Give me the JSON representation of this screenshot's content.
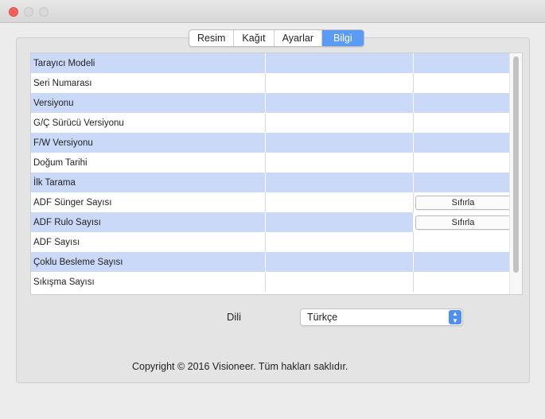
{
  "tabs": [
    {
      "label": "Resim",
      "active": false
    },
    {
      "label": "Kağıt",
      "active": false
    },
    {
      "label": "Ayarlar",
      "active": false
    },
    {
      "label": "Bilgi",
      "active": true
    }
  ],
  "rows": [
    {
      "label": "Tarayıcı Modeli",
      "value": "",
      "extra": ""
    },
    {
      "label": "Seri Numarası",
      "value": "",
      "extra": ""
    },
    {
      "label": "Versiyonu",
      "value": "",
      "extra": ""
    },
    {
      "label": "G/Ç Sürücü Versiyonu",
      "value": "",
      "extra": ""
    },
    {
      "label": "F/W Versiyonu",
      "value": "",
      "extra": ""
    },
    {
      "label": "Doğum Tarihi",
      "value": "",
      "extra": ""
    },
    {
      "label": "İlk Tarama",
      "value": "",
      "extra": ""
    },
    {
      "label": "ADF Sünger Sayısı",
      "value": "",
      "extra": "",
      "button": "Sıfırla"
    },
    {
      "label": "ADF Rulo Sayısı",
      "value": "",
      "extra": "",
      "button": "Sıfırla"
    },
    {
      "label": "ADF Sayısı",
      "value": "",
      "extra": ""
    },
    {
      "label": "Çoklu Besleme Sayısı",
      "value": "",
      "extra": ""
    },
    {
      "label": "Sıkışma Sayısı",
      "value": "",
      "extra": ""
    }
  ],
  "language": {
    "label": "Dili",
    "selected": "Türkçe"
  },
  "copyright": "Copyright © 2016 Visioneer. Tüm hakları saklıdır.",
  "colors": {
    "accent": "#5a9cf5",
    "row_alt": "#c9d9f7",
    "close": "#fc605c"
  }
}
